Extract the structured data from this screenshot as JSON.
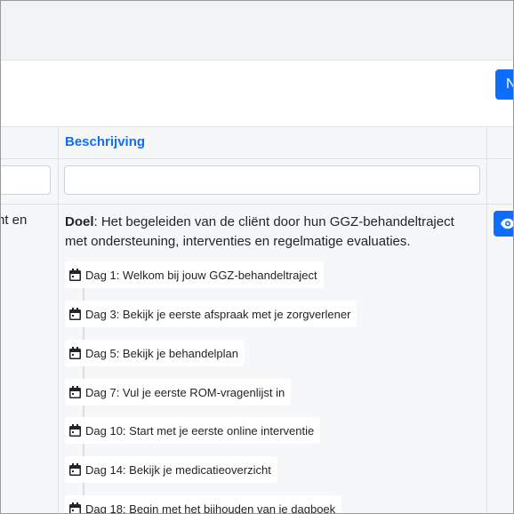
{
  "toolbar": {
    "new_button_label": "N"
  },
  "table": {
    "column_description_header": "Beschrijving",
    "row": {
      "left_cell_text": "nt en",
      "goal_label": "Doel",
      "goal_text": ": Het begeleiden van de cliënt door hun GGZ-behandeltraject met ondersteuning, interventies en regelmatige evaluaties.",
      "days": [
        {
          "label": "Dag 1: Welkom bij jouw GGZ-behandeltraject"
        },
        {
          "label": "Dag 3: Bekijk je eerste afspraak met je zorgverlener"
        },
        {
          "label": "Dag 5: Bekijk je behandelplan"
        },
        {
          "label": "Dag 7: Vul je eerste ROM-vragenlijst in"
        },
        {
          "label": "Dag 10: Start met je eerste online interventie"
        },
        {
          "label": "Dag 14: Bekijk je medicatieoverzicht"
        },
        {
          "label": "Dag 18: Begin met het bijhouden van je dagboek"
        }
      ]
    }
  },
  "icons": {
    "day_icon": "calendar-icon",
    "view_icon": "eye-icon"
  },
  "colors": {
    "accent": "#0d6efd",
    "header_bg": "#f2f3f6",
    "row_bg": "#f6f7f8"
  }
}
